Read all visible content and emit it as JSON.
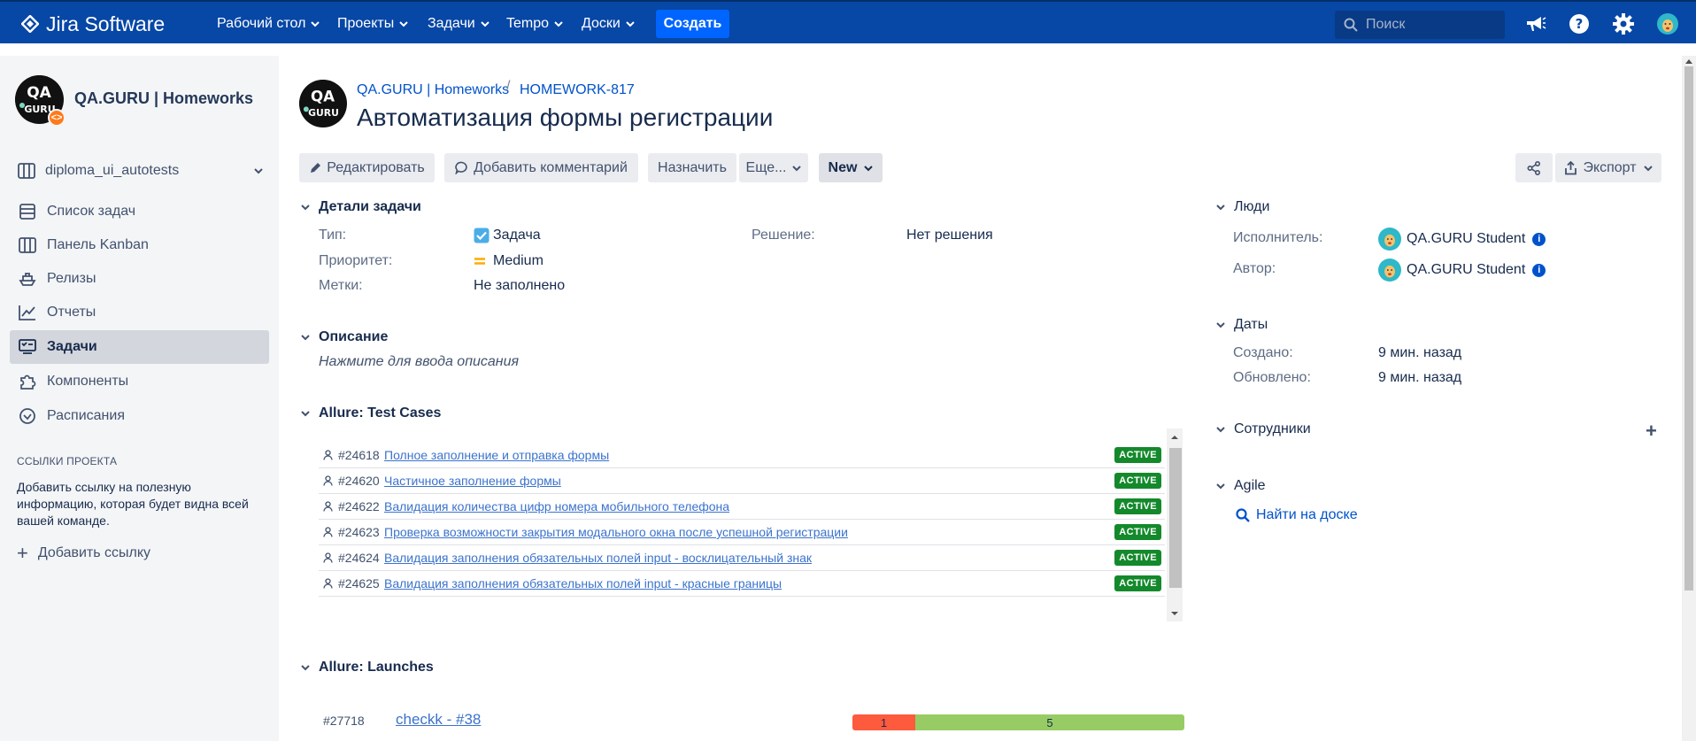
{
  "topnav": {
    "logo": "Jira Software",
    "menu": [
      {
        "label": "Рабочий стол"
      },
      {
        "label": "Проекты"
      },
      {
        "label": "Задачи"
      },
      {
        "label": "Tempo"
      },
      {
        "label": "Доски"
      }
    ],
    "create_label": "Создать",
    "search_placeholder": "Поиск",
    "icons": [
      "notifications-megaphone-icon",
      "help-icon",
      "settings-gear-icon",
      "user-avatar"
    ]
  },
  "sidebar": {
    "project_name": "QA.GURU | Homeworks",
    "board_selector": "diploma_ui_autotests",
    "items": [
      {
        "label": "Список задач",
        "icon": "backlog-icon"
      },
      {
        "label": "Панель Kanban",
        "icon": "board-icon"
      },
      {
        "label": "Релизы",
        "icon": "ship-icon"
      },
      {
        "label": "Отчеты",
        "icon": "chart-icon"
      },
      {
        "label": "Задачи",
        "icon": "issues-icon",
        "active": true
      },
      {
        "label": "Компоненты",
        "icon": "puzzle-icon"
      },
      {
        "label": "Расписания",
        "icon": "clock-icon"
      }
    ],
    "links_section_title": "ССЫЛКИ ПРОЕКТА",
    "links_help": "Добавить ссылку на полезную информацию, которая будет видна всей вашей команде.",
    "add_link_label": "Добавить ссылку"
  },
  "issue": {
    "breadcrumb_project": "QA.GURU | Homeworks",
    "breadcrumb_separator": "/",
    "breadcrumb_key": "HOMEWORK-817",
    "title": "Автоматизация формы регистрации",
    "toolbar": {
      "edit": "Редактировать",
      "comment": "Добавить комментарий",
      "assign": "Назначить",
      "more": "Еще...",
      "status": "New",
      "export": "Экспорт"
    },
    "details": {
      "section_title": "Детали задачи",
      "type_label": "Тип:",
      "type_value": "Задача",
      "priority_label": "Приоритет:",
      "priority_value": "Medium",
      "labels_label": "Метки:",
      "labels_value": "Не заполнено",
      "resolution_label": "Решение:",
      "resolution_value": "Нет решения"
    },
    "description": {
      "section_title": "Описание",
      "placeholder": "Нажмите для ввода описания"
    },
    "test_cases": {
      "section_title": "Allure: Test Cases",
      "rows": [
        {
          "id": "#24618",
          "name": "Полное заполнение и отправка формы",
          "status": "ACTIVE"
        },
        {
          "id": "#24620",
          "name": "Частичное заполнение формы",
          "status": "ACTIVE"
        },
        {
          "id": "#24622",
          "name": "Валидация количества цифр номера мобильного телефона",
          "status": "ACTIVE"
        },
        {
          "id": "#24623",
          "name": "Проверка возможности закрытия модального окна после успешной регистрации",
          "status": "ACTIVE"
        },
        {
          "id": "#24624",
          "name": "Валидация заполнения обязательных полей input - восклицательный знак",
          "status": "ACTIVE"
        },
        {
          "id": "#24625",
          "name": "Валидация заполнения обязательных полей input - красные границы",
          "status": "ACTIVE"
        }
      ]
    },
    "launches": {
      "section_title": "Allure: Launches",
      "rows": [
        {
          "id": "#27718",
          "name": "checkk - #38",
          "failed": "1",
          "passed": "5",
          "failed_fraction": 0.19
        }
      ]
    },
    "people": {
      "section_title": "Люди",
      "assignee_label": "Исполнитель:",
      "assignee": "QA.GURU Student",
      "reporter_label": "Автор:",
      "reporter": "QA.GURU Student"
    },
    "dates": {
      "section_title": "Даты",
      "created_label": "Создано:",
      "created": "9 мин. назад",
      "updated_label": "Обновлено:",
      "updated": "9 мин. назад"
    },
    "employees": {
      "section_title": "Сотрудники"
    },
    "agile": {
      "section_title": "Agile",
      "find_on_board": "Найти на доске"
    }
  },
  "colors": {
    "topbar": "#0747a6",
    "create_button": "#0065ff",
    "link": "#0052cc",
    "active_badge": "#14892c",
    "launch_failed": "#fd5a3e",
    "launch_passed": "#97cc64"
  }
}
